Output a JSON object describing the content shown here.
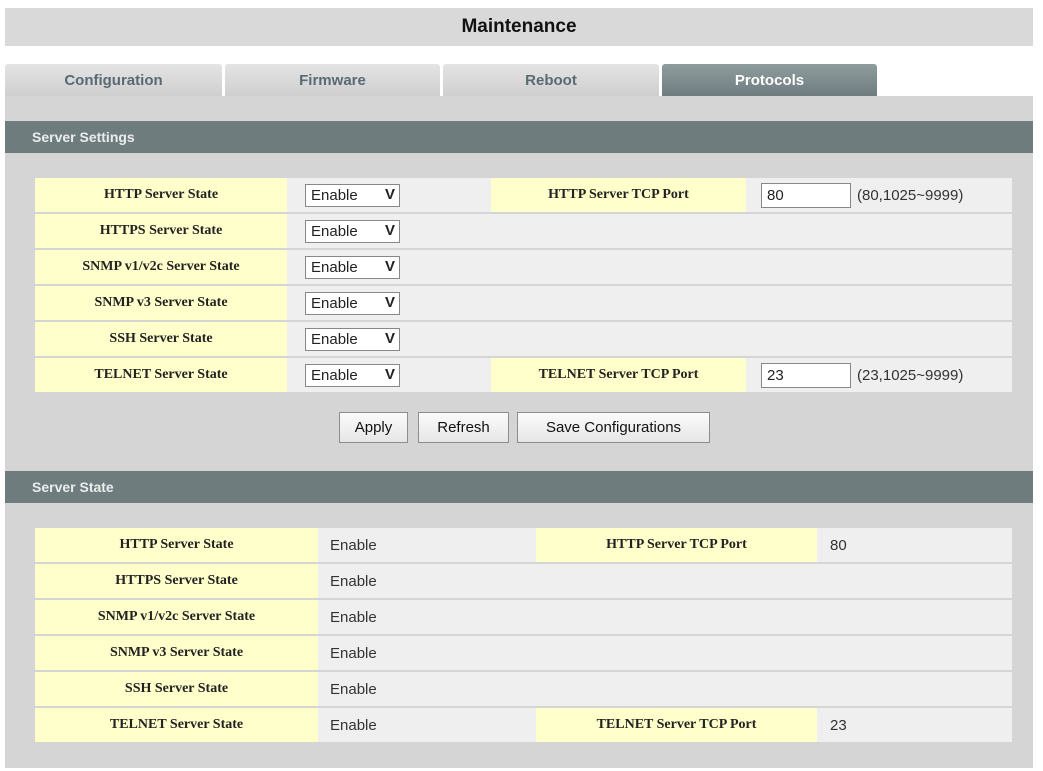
{
  "page": {
    "title": "Maintenance"
  },
  "tabs": [
    {
      "label": "Configuration",
      "active": false
    },
    {
      "label": "Firmware",
      "active": false
    },
    {
      "label": "Reboot",
      "active": false
    },
    {
      "label": "Protocols",
      "active": true
    }
  ],
  "server_settings": {
    "header": "Server Settings",
    "rows": [
      {
        "label": "HTTP Server State",
        "value": "Enable",
        "port_label": "HTTP Server TCP Port",
        "port_value": "80",
        "port_hint": "(80,1025~9999)"
      },
      {
        "label": "HTTPS Server State",
        "value": "Enable"
      },
      {
        "label": "SNMP v1/v2c Server State",
        "value": "Enable"
      },
      {
        "label": "SNMP v3 Server State",
        "value": "Enable"
      },
      {
        "label": "SSH Server State",
        "value": "Enable"
      },
      {
        "label": "TELNET Server State",
        "value": "Enable",
        "port_label": "TELNET Server TCP Port",
        "port_value": "23",
        "port_hint": "(23,1025~9999)"
      }
    ],
    "select_chevron": "V"
  },
  "buttons": {
    "apply": "Apply",
    "refresh": "Refresh",
    "save": "Save Configurations"
  },
  "server_state": {
    "header": "Server State",
    "rows": [
      {
        "label": "HTTP Server State",
        "value": "Enable",
        "port_label": "HTTP Server TCP Port",
        "port_value": "80"
      },
      {
        "label": "HTTPS Server State",
        "value": "Enable"
      },
      {
        "label": "SNMP v1/v2c Server State",
        "value": "Enable"
      },
      {
        "label": "SNMP v3 Server State",
        "value": "Enable"
      },
      {
        "label": "SSH Server State",
        "value": "Enable"
      },
      {
        "label": "TELNET Server State",
        "value": "Enable",
        "port_label": "TELNET Server TCP Port",
        "port_value": "23"
      }
    ]
  },
  "colors": {
    "label_bg": "#ffffcc",
    "section_header_bg": "#6f7c7e",
    "active_tab_bg": "#7f8c8f",
    "panel_bg": "#d5d5d5"
  }
}
